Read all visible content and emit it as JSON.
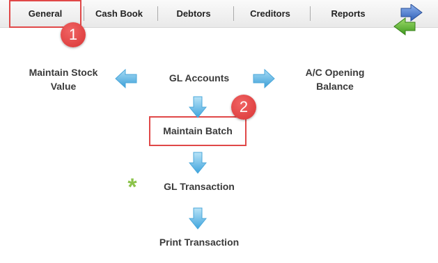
{
  "nav": {
    "tabs": [
      {
        "label": "General"
      },
      {
        "label": "Cash Book"
      },
      {
        "label": "Debtors"
      },
      {
        "label": "Creditors"
      },
      {
        "label": "Reports"
      }
    ]
  },
  "callouts": [
    "1",
    "2"
  ],
  "flow": {
    "maintain_stock_value": "Maintain Stock Value",
    "gl_accounts": "GL Accounts",
    "ac_opening_balance": "A/C Opening Balance",
    "maintain_batch": "Maintain Batch",
    "gl_transaction": "GL Transaction",
    "print_transaction": "Print Transaction",
    "required_marker": "*"
  },
  "icons": {
    "nav_forward": "arrow-right-icon",
    "nav_back": "arrow-left-icon",
    "flow_arrow": "arrow-icon"
  },
  "colors": {
    "highlight": "#e04848",
    "callout": "#d93434",
    "flow_arrow": "#5bb6e6",
    "asterisk": "#8bc34a",
    "nav_forward": "#3f6fc4",
    "nav_back": "#5cb030"
  }
}
